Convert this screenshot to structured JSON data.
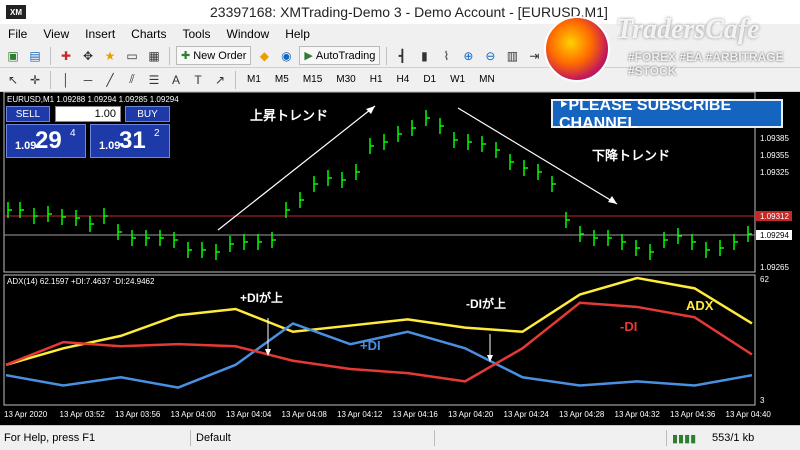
{
  "window": {
    "app_logo": "XM",
    "title": "23397168: XMTrading-Demo 3 - Demo Account - [EURUSD,M1]"
  },
  "menu": [
    "File",
    "View",
    "Insert",
    "Charts",
    "Tools",
    "Window",
    "Help"
  ],
  "toolbar": {
    "new_order_label": "New Order",
    "autotrading_label": "AutoTrading",
    "timeframes": [
      "M1",
      "M5",
      "M15",
      "M30",
      "H1",
      "H4",
      "D1",
      "W1",
      "MN"
    ]
  },
  "watermark": {
    "title": "TradersCafe",
    "subtitle": "#FOREX #EA #ARBITRAGE #STOCK"
  },
  "subscribe_banner": "‣PLEASE SUBSCRIBE CHANNEL",
  "trade_panel": {
    "sell_label": "SELL",
    "buy_label": "BUY",
    "lot": "1.00",
    "sell_price_prefix": "1.09",
    "sell_price_big": "29",
    "sell_price_sup": "4",
    "buy_price_prefix": "1.09",
    "buy_price_big": "31",
    "buy_price_sup": "2"
  },
  "price_chart": {
    "header": "EURUSD,M1  1.09288 1.09294 1.09285 1.09294",
    "annotation_up": "上昇トレンド",
    "annotation_down": "下降トレンド",
    "y_ticks": [
      "1.09385",
      "1.09355",
      "1.09325",
      "1.09294",
      "1.09265"
    ],
    "current_price": "1.09294",
    "red_line_price": "1.09312",
    "candle_color": "#00ff00"
  },
  "chart_data": {
    "type": "line",
    "title": "ADX(14) 62.1597 +DI:7.4637 -DI:24.9462",
    "x": [
      "13 Apr 2020",
      "13 Apr 03:52",
      "13 Apr 03:56",
      "13 Apr 04:00",
      "13 Apr 04:04",
      "13 Apr 04:08",
      "13 Apr 04:12",
      "13 Apr 04:16",
      "13 Apr 04:20",
      "13 Apr 04:24",
      "13 Apr 04:28",
      "13 Apr 04:32",
      "13 Apr 04:36",
      "13 Apr 04:40"
    ],
    "ylim": [
      3,
      62
    ],
    "y_ticks": [
      "62",
      "3"
    ],
    "series": [
      {
        "name": "ADX",
        "color": "#ffeb3b",
        "values": [
          20,
          28,
          34,
          44,
          47,
          36,
          39,
          42,
          38,
          36,
          54,
          62,
          57,
          40
        ]
      },
      {
        "name": "+DI",
        "color": "#4a90e2",
        "values": [
          15,
          10,
          14,
          9,
          20,
          40,
          30,
          36,
          28,
          14,
          10,
          12,
          10,
          15
        ]
      },
      {
        "name": "-DI",
        "color": "#e53935",
        "values": [
          20,
          31,
          29,
          30,
          29,
          22,
          18,
          16,
          12,
          28,
          50,
          48,
          43,
          25
        ]
      }
    ],
    "annotations": [
      "+DIが上",
      "-DIが上",
      "+DI",
      "-DI",
      "ADX"
    ]
  },
  "status": {
    "help": "For Help, press F1",
    "profile": "Default",
    "traffic": "553/1 kb"
  }
}
